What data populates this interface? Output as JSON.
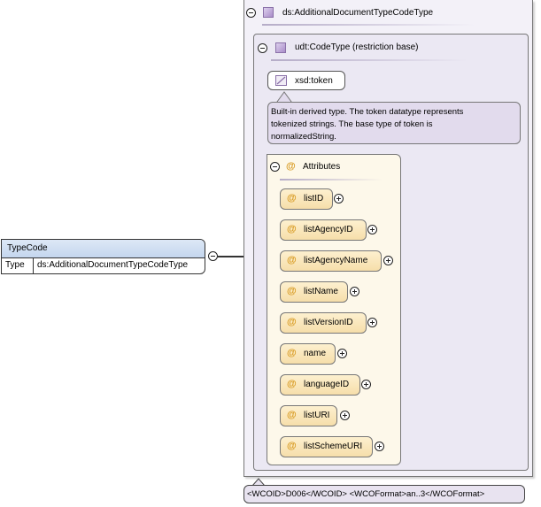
{
  "element": {
    "name": "TypeCode",
    "type_label": "Type",
    "type_value": "ds:AdditionalDocumentTypeCodeType"
  },
  "complex_type": {
    "name": "ds:AdditionalDocumentTypeCodeType",
    "restriction_base": "udt:CodeType (restriction base)",
    "simple_type": "xsd:token",
    "documentation_lines": [
      "Built-in derived type. The token datatype represents",
      "tokenized strings. The base type of token is",
      "normalizedString."
    ]
  },
  "attributes_group": {
    "label": "Attributes",
    "items": [
      "listID",
      "listAgencyID",
      "listAgencyName",
      "listName",
      "listVersionID",
      "name",
      "languageID",
      "listURI",
      "listSchemeURI"
    ]
  },
  "annotation": "<WCOID>D006</WCOID> <WCOFormat>an..3</WCOFormat>",
  "colors": {
    "element_header": "#c4d6ee",
    "complex_type_bg": "#f3f1f8",
    "attribute_fill": "#f6deaa",
    "attribute_icon": "#d89a20",
    "documentation_bg": "#e2dbed"
  },
  "icons": {
    "type": "complex-type-icon",
    "attribute": "attribute-at-icon",
    "collapse": "minus-circle-icon",
    "expand": "plus-circle-icon"
  }
}
